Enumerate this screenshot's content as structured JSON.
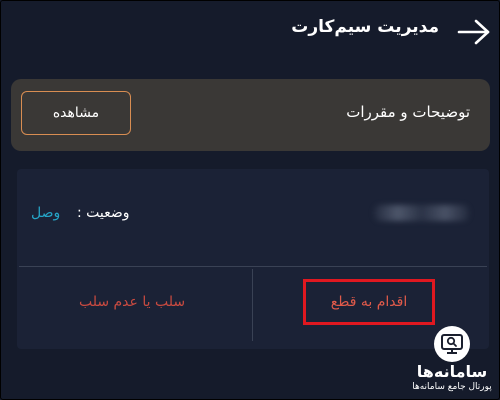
{
  "header": {
    "title": "مدیریت سیم‌کارت",
    "back_icon": "arrow-right-icon"
  },
  "terms": {
    "label": "توضیحات و مقررات",
    "view_button": "مشاهده"
  },
  "sim": {
    "status_label": "وضعیت :",
    "status_value": "وصل",
    "actions": {
      "disconnect": "اقدام به قطع",
      "block_unblock": "سلب یا عدم سلب"
    }
  },
  "watermark": {
    "title": "سامانه‌ها",
    "subtitle": "پورتال جامع سامانه‌ها"
  },
  "colors": {
    "background": "#151b2b",
    "card": "#3a3836",
    "accent_border": "#d88d52",
    "status_connected": "#25a5c7",
    "danger": "#e01820"
  }
}
